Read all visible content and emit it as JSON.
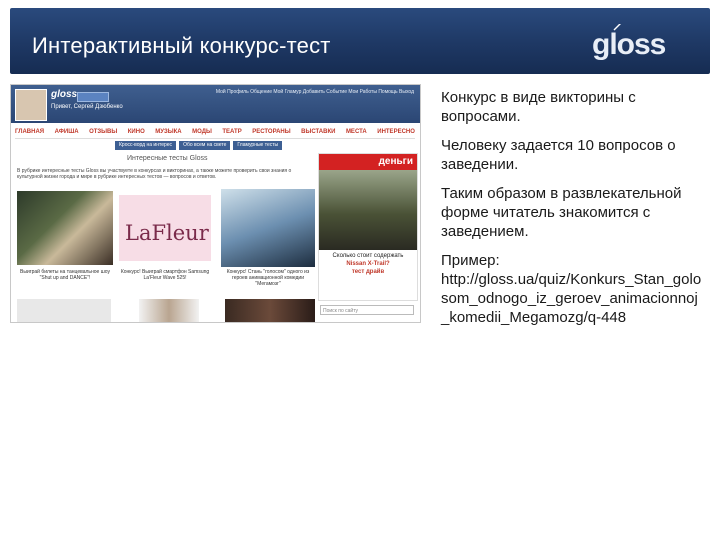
{
  "slide": {
    "title": "Интерактивный конкурс-тест",
    "logo_text": "gloss",
    "paragraphs": [
      "Конкурс в виде викторины с вопросами.",
      "Человеку задается 10 вопросов о заведении.",
      "Таким образом в развлекательной форме читатель знакомится с заведением."
    ],
    "example_label": "Пример:",
    "example_url": "http://gloss.ua/quiz/Konkurs_Stan_golosom_odnogo_iz_geroev_animacionnoj_komedii_Megamozg/q-448"
  },
  "screenshot": {
    "site_logo": "gloss",
    "search_button": "Поиск",
    "user_line": "Привет, Сергей Дзюбенко",
    "top_menu": "Мой Профиль   Общение   Мой Гламур   Добавить Событие   Мои Работы   Помощь   Выход",
    "nav": [
      "ГЛАВНАЯ",
      "АФИША",
      "ОТЗЫВЫ",
      "КИНО",
      "МУЗЫКА",
      "МОДЫ",
      "ТЕАТР",
      "РЕСТОРАНЫ",
      "ВЫСТАВКИ",
      "МЕСТА",
      "ИНТЕРЕСНО"
    ],
    "subnav": [
      "Кросс-ворд на интерес",
      "Обо всем на свете",
      "Гламурные тесты"
    ],
    "section_heading": "Интересные тесты Gloss",
    "description": "В рубрике интересные тесты Gloss вы участвуете в конкурсах и викторинах, а также можете проверить свои знания о культурной жизни города и мире в рубрике интересных тестов — вопросов и ответов.",
    "lafleur": "LaFleur",
    "captions": [
      "Выиграй билеты на танцевальное шоу \"Shut up and DANCE\"!",
      "Конкурс! Выиграй смартфон Samsung La'Fleur Wave 525!",
      "Конкурс! Стань \"голосом\" одного из героев анимационной комедии \"Мегамозг\""
    ],
    "ad_heading": "деньги",
    "ad_question": "Сколько стоит содержать",
    "ad_model": "Nissan X-Trail?",
    "ad_action": "тест драйв",
    "search_placeholder": "Поиск по сайту"
  },
  "colors": {
    "header_bg": "#1e3864",
    "header_text": "#ffffff",
    "body_text": "#1a1a1a",
    "nav_red": "#c0392b"
  }
}
